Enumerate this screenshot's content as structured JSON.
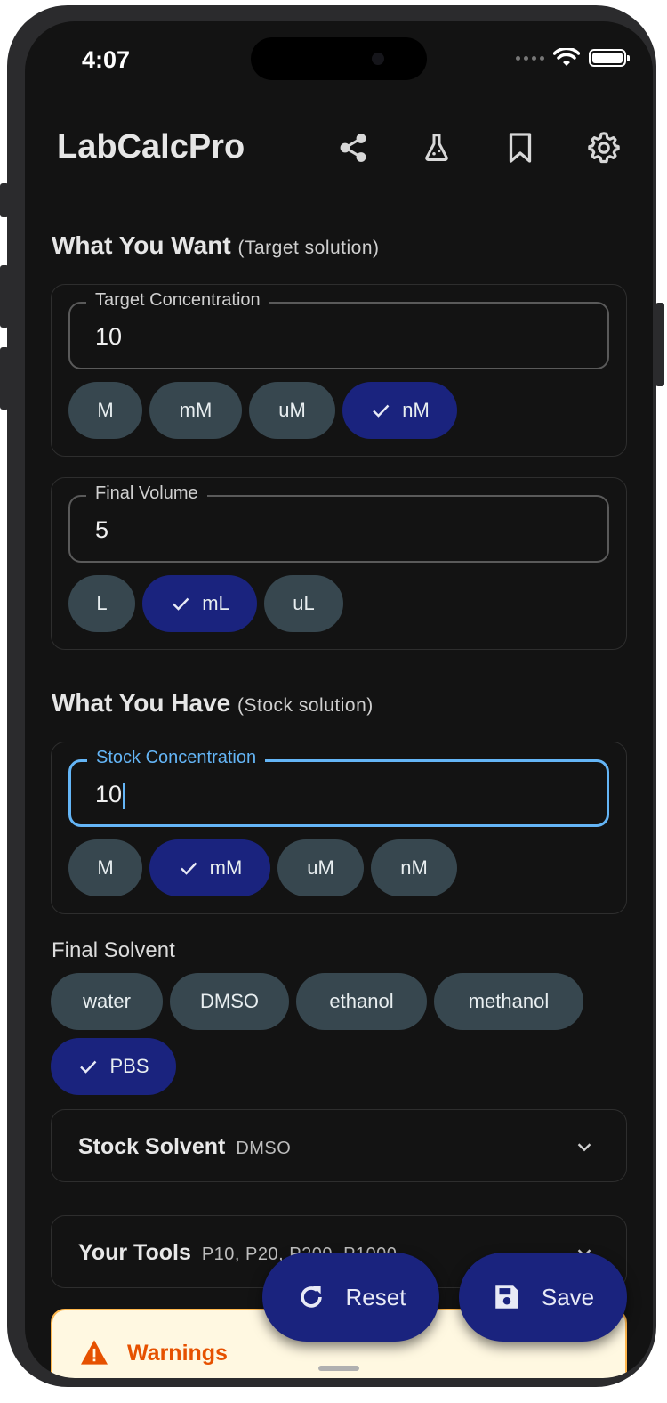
{
  "status_bar": {
    "time": "4:07"
  },
  "app_bar": {
    "title": "LabCalcPro",
    "icons": [
      "share-icon",
      "flask-icon",
      "bookmark-icon",
      "settings-icon"
    ]
  },
  "target_section": {
    "title": "What You Want",
    "subtitle": "(Target solution)"
  },
  "target_concentration": {
    "label": "Target Concentration",
    "value": "10",
    "units": [
      "M",
      "mM",
      "uM",
      "nM"
    ],
    "selected_unit": "nM"
  },
  "final_volume": {
    "label": "Final Volume",
    "value": "5",
    "units": [
      "L",
      "mL",
      "uL"
    ],
    "selected_unit": "mL"
  },
  "stock_section": {
    "title": "What You Have",
    "subtitle": "(Stock solution)"
  },
  "stock_concentration": {
    "label": "Stock Concentration",
    "value": "10",
    "units": [
      "M",
      "mM",
      "uM",
      "nM"
    ],
    "selected_unit": "mM"
  },
  "final_solvent": {
    "label": "Final Solvent",
    "options": [
      "water",
      "DMSO",
      "ethanol",
      "methanol",
      "PBS"
    ],
    "selected": "PBS"
  },
  "stock_solvent": {
    "title": "Stock Solvent",
    "value": "DMSO"
  },
  "tools": {
    "title": "Your Tools",
    "value": "P10, P20, P200, P1000"
  },
  "warnings": {
    "title": "Warnings"
  },
  "actions": {
    "reset_label": "Reset",
    "save_label": "Save"
  },
  "colors": {
    "background": "#131313",
    "chip": "#37474f",
    "chip_selected": "#1a237e",
    "focus": "#64b5f6",
    "warning_bg": "#fff8e1",
    "warning_text": "#e65100"
  }
}
